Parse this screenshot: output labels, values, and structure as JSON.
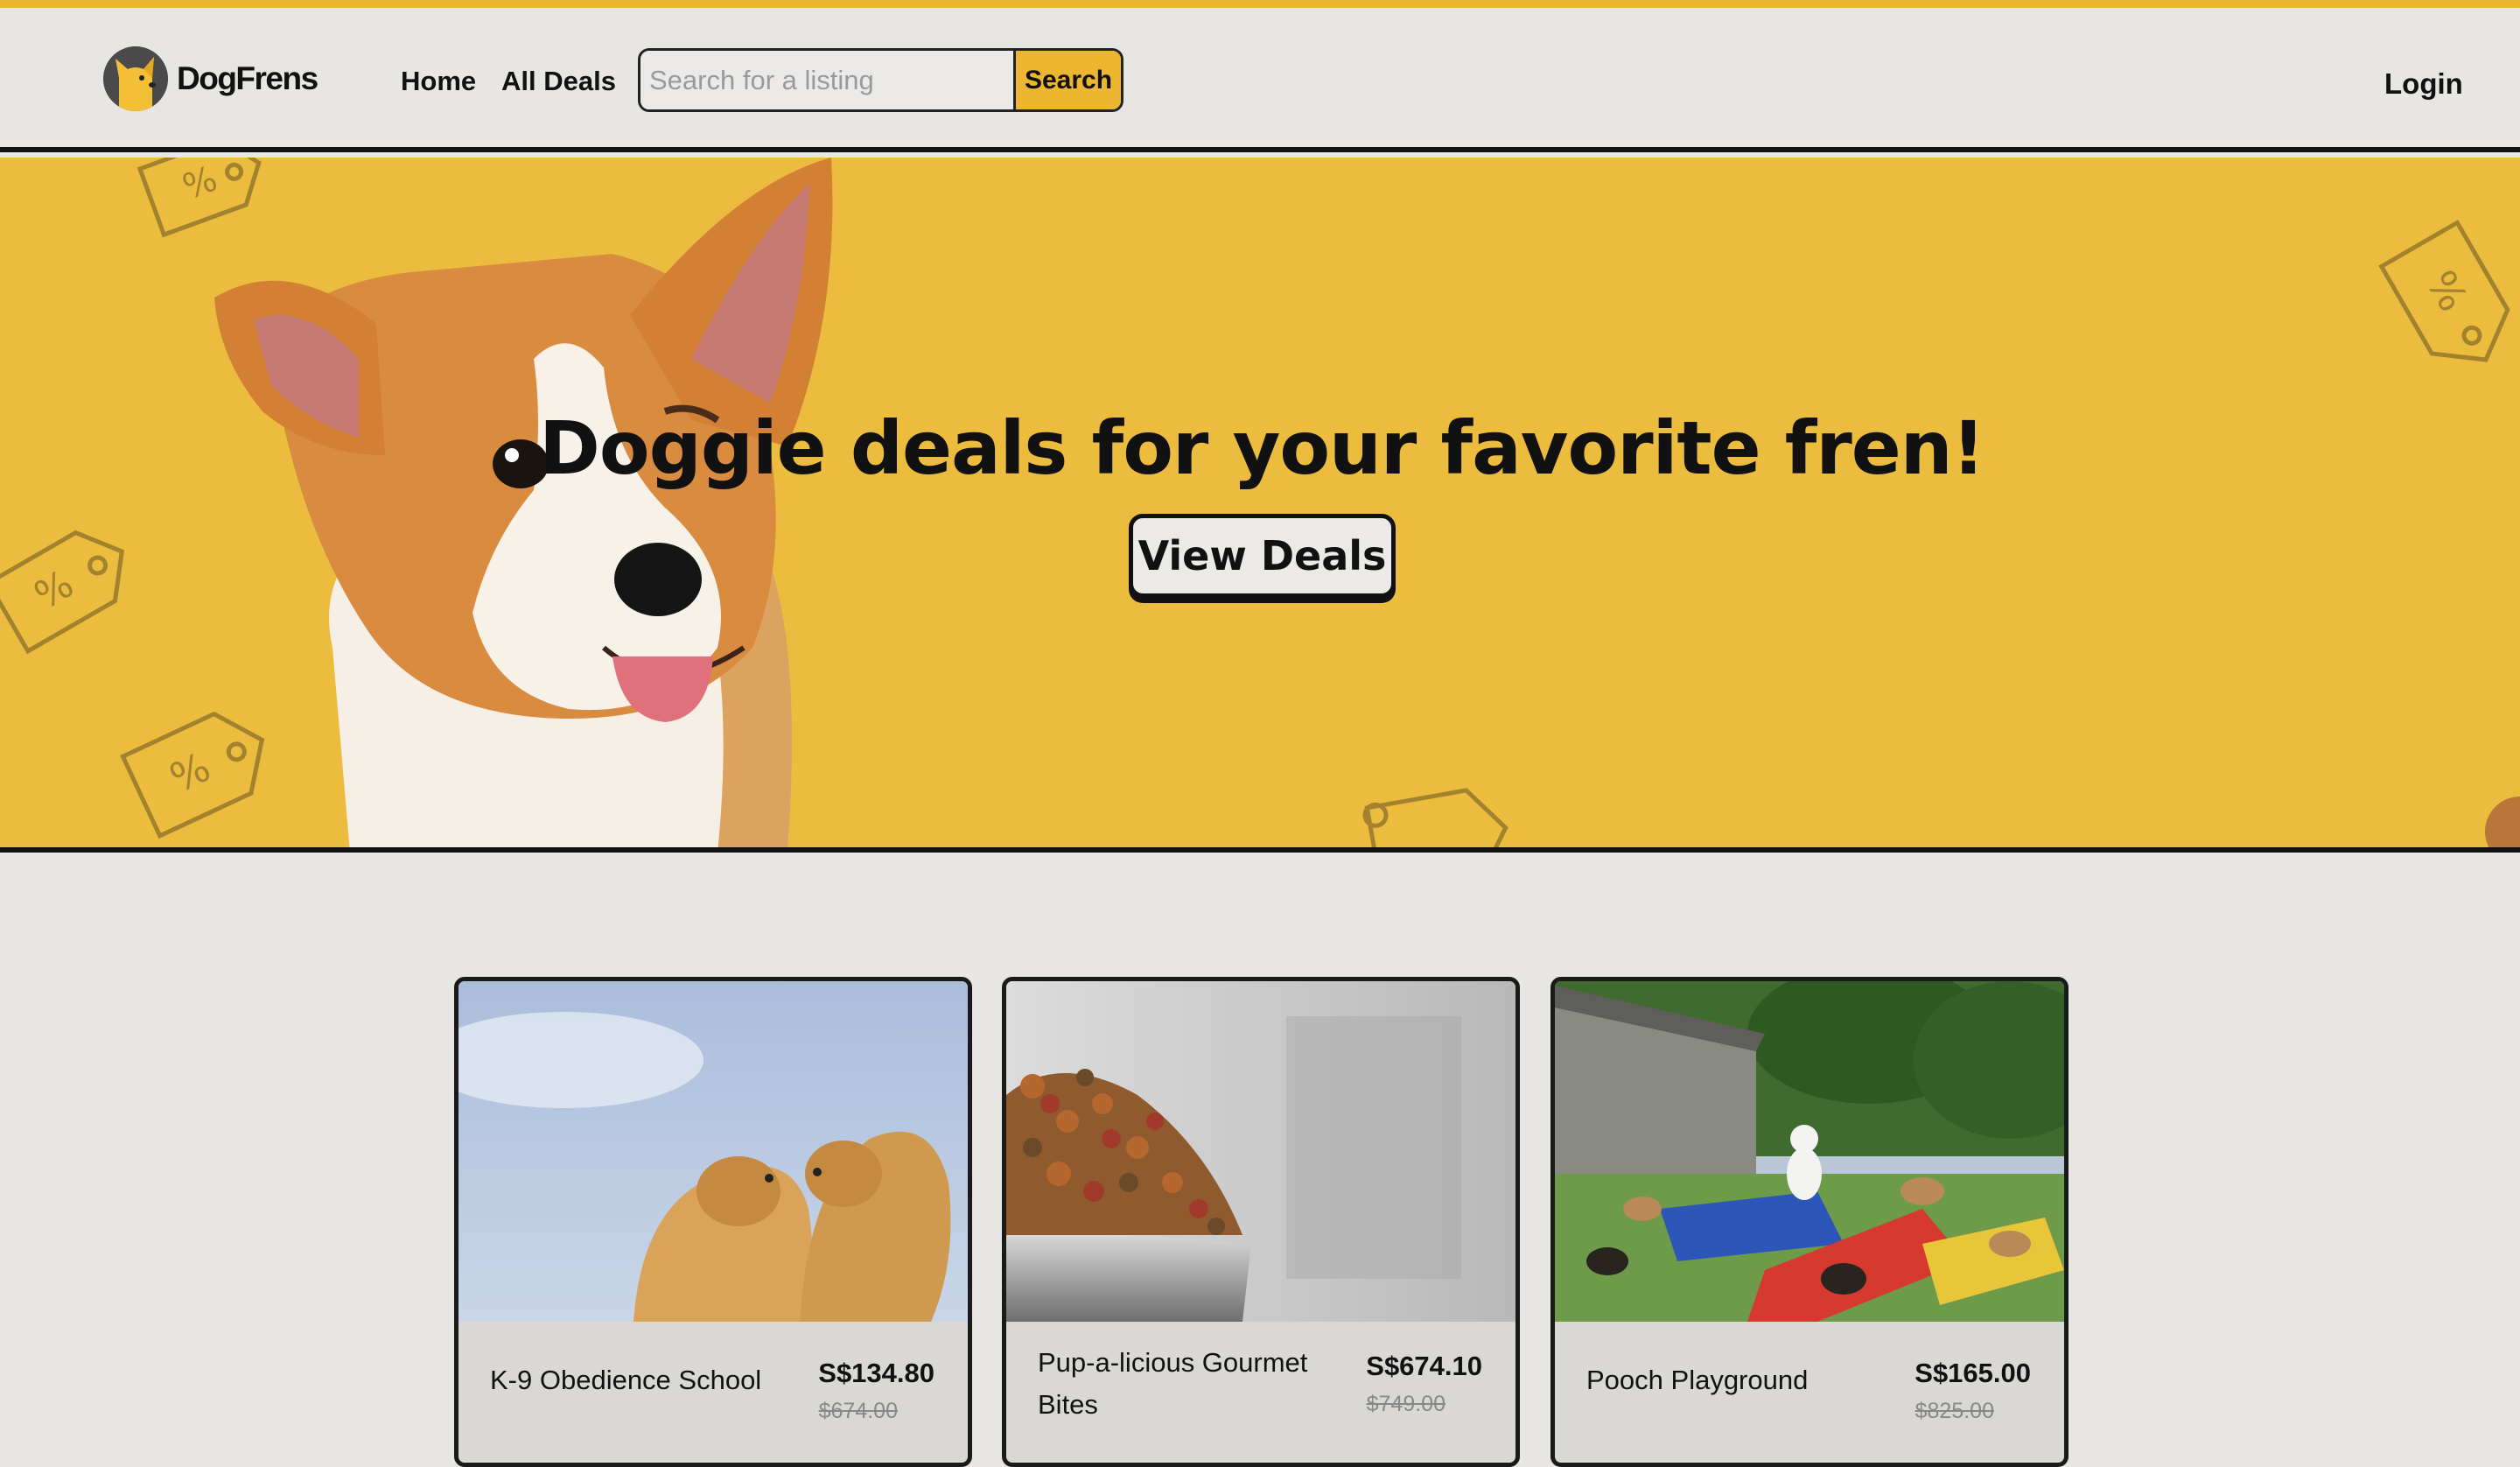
{
  "header": {
    "brand": "DogFrens",
    "nav": {
      "home": "Home",
      "all_deals": "All Deals",
      "login": "Login"
    },
    "search": {
      "placeholder": "Search for a listing",
      "value": "",
      "button": "Search"
    }
  },
  "hero": {
    "title": "Doggie deals for your favorite fren!",
    "cta": "View Deals"
  },
  "deals": [
    {
      "title": "K-9 Obedience School",
      "price": "S$134.80",
      "original_price": "$674.00"
    },
    {
      "title": "Pup-a-licious Gourmet Bites",
      "price": "S$674.10",
      "original_price": "$749.00"
    },
    {
      "title": "Pooch Playground",
      "price": "S$165.00",
      "original_price": "$825.00"
    }
  ],
  "colors": {
    "accent": "#ecb630",
    "hero_bg": "#ecbc3e",
    "page_bg": "#e8e6e3",
    "outline": "#111111"
  }
}
